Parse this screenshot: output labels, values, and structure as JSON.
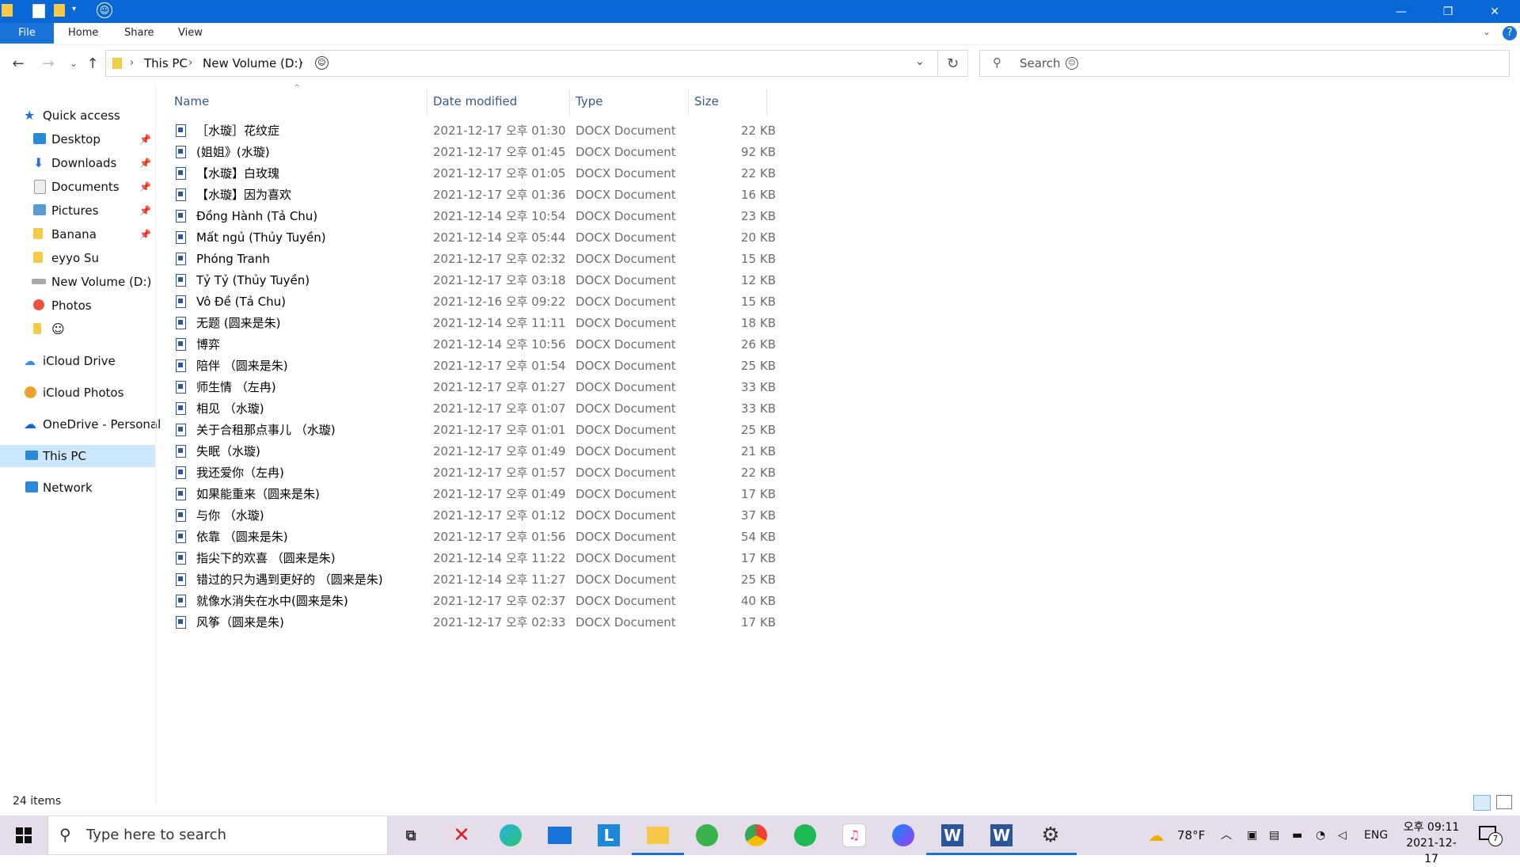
{
  "window": {
    "quick_access_glyph": "☺",
    "minimize_glyph": "—",
    "restore_glyph": "❐",
    "close_glyph": "✕"
  },
  "ribbon": {
    "tabs": [
      "File",
      "Home",
      "Share",
      "View"
    ],
    "help_glyph": "?"
  },
  "address": {
    "crumbs": [
      "This PC",
      "New Volume (D:)"
    ],
    "extra_glyph": "☺",
    "search_placeholder": "Search",
    "search_glyph": "☺"
  },
  "sidebar": {
    "quick_access": "Quick access",
    "items": [
      {
        "label": "Desktop",
        "pinned": true,
        "icon": "desktop-icon"
      },
      {
        "label": "Downloads",
        "pinned": true,
        "icon": "download-icon"
      },
      {
        "label": "Documents",
        "pinned": true,
        "icon": "documents-icon"
      },
      {
        "label": "Pictures",
        "pinned": true,
        "icon": "pictures-icon"
      },
      {
        "label": "Banana",
        "pinned": true,
        "icon": "folder-icon"
      },
      {
        "label": "eyyo Su",
        "pinned": false,
        "icon": "folder-icon"
      },
      {
        "label": "New Volume (D:)",
        "pinned": false,
        "icon": "drive-icon"
      },
      {
        "label": "Photos",
        "pinned": false,
        "icon": "photos-icon"
      },
      {
        "label": "☺",
        "pinned": false,
        "icon": "folder-icon"
      }
    ],
    "icloud_drive": "iCloud Drive",
    "icloud_photos": "iCloud Photos",
    "onedrive": "OneDrive - Personal",
    "this_pc": "This PC",
    "network": "Network"
  },
  "columns": {
    "name": "Name",
    "date": "Date modified",
    "type": "Type",
    "size": "Size"
  },
  "files": [
    {
      "name": "［水璇］花纹症",
      "date": "2021-12-17 오후 01:30",
      "type": "DOCX Document",
      "size": "22 KB"
    },
    {
      "name": "(姐姐》(水璇)",
      "date": "2021-12-17 오후 01:45",
      "type": "DOCX Document",
      "size": "92 KB"
    },
    {
      "name": "【水璇】白玫瑰",
      "date": "2021-12-17 오후 01:05",
      "type": "DOCX Document",
      "size": "22 KB"
    },
    {
      "name": "【水璇】因为喜欢",
      "date": "2021-12-17 오후 01:36",
      "type": "DOCX Document",
      "size": "16 KB"
    },
    {
      "name": "Đồng Hành (Tả Chu)",
      "date": "2021-12-14 오후 10:54",
      "type": "DOCX Document",
      "size": "23 KB"
    },
    {
      "name": "Mất ngủ (Thủy Tuyền)",
      "date": "2021-12-14 오후 05:44",
      "type": "DOCX Document",
      "size": "20 KB"
    },
    {
      "name": "Phóng Tranh",
      "date": "2021-12-17 오후 02:32",
      "type": "DOCX Document",
      "size": "15 KB"
    },
    {
      "name": "Tỷ Tỷ (Thủy Tuyền)",
      "date": "2021-12-17 오후 03:18",
      "type": "DOCX Document",
      "size": "12 KB"
    },
    {
      "name": "Vô Đề (Tả Chu)",
      "date": "2021-12-16 오후 09:22",
      "type": "DOCX Document",
      "size": "15 KB"
    },
    {
      "name": "无题 (圆来是朱)",
      "date": "2021-12-14 오후 11:11",
      "type": "DOCX Document",
      "size": "18 KB"
    },
    {
      "name": "博弈",
      "date": "2021-12-14 오후 10:56",
      "type": "DOCX Document",
      "size": "26 KB"
    },
    {
      "name": "陪伴 （圆来是朱)",
      "date": "2021-12-17 오후 01:54",
      "type": "DOCX Document",
      "size": "25 KB"
    },
    {
      "name": "师生情 （左冉)",
      "date": "2021-12-17 오후 01:27",
      "type": "DOCX Document",
      "size": "33 KB"
    },
    {
      "name": "相见 （水璇)",
      "date": "2021-12-17 오후 01:07",
      "type": "DOCX Document",
      "size": "33 KB"
    },
    {
      "name": "关于合租那点事儿 （水璇)",
      "date": "2021-12-17 오후 01:01",
      "type": "DOCX Document",
      "size": "25 KB"
    },
    {
      "name": "失眠（水璇)",
      "date": "2021-12-17 오후 01:49",
      "type": "DOCX Document",
      "size": "21 KB"
    },
    {
      "name": "我还爱你（左冉)",
      "date": "2021-12-17 오후 01:57",
      "type": "DOCX Document",
      "size": "22 KB"
    },
    {
      "name": "如果能重来（圆来是朱)",
      "date": "2021-12-17 오후 01:49",
      "type": "DOCX Document",
      "size": "17 KB"
    },
    {
      "name": "与你 （水璇)",
      "date": "2021-12-17 오후 01:12",
      "type": "DOCX Document",
      "size": "37 KB"
    },
    {
      "name": "依靠 （圆来是朱)",
      "date": "2021-12-17 오후 01:56",
      "type": "DOCX Document",
      "size": "54 KB"
    },
    {
      "name": "指尖下的欢喜 （圆来是朱)",
      "date": "2021-12-14 오후 11:22",
      "type": "DOCX Document",
      "size": "17 KB"
    },
    {
      "name": "错过的只为遇到更好的 （圆来是朱)",
      "date": "2021-12-14 오후 11:27",
      "type": "DOCX Document",
      "size": "25 KB"
    },
    {
      "name": "就像水消失在水中(圆来是朱)",
      "date": "2021-12-17 오후 02:37",
      "type": "DOCX Document",
      "size": "40 KB"
    },
    {
      "name": "风筝（圆来是朱)",
      "date": "2021-12-17 오후 02:33",
      "type": "DOCX Document",
      "size": "17 KB"
    }
  ],
  "status": {
    "items_count": "24 items"
  },
  "taskbar": {
    "search_placeholder": "Type here to search",
    "weather_temp": "78°F",
    "language": "ENG",
    "time": "오후 09:11",
    "date": "2021-12-17",
    "notification_count": "7"
  },
  "colors": {
    "titlebar": "#0a67d6",
    "accent": "#1a73d9",
    "selected_nav": "#cce8ff",
    "taskbar": "#e6ddea"
  }
}
